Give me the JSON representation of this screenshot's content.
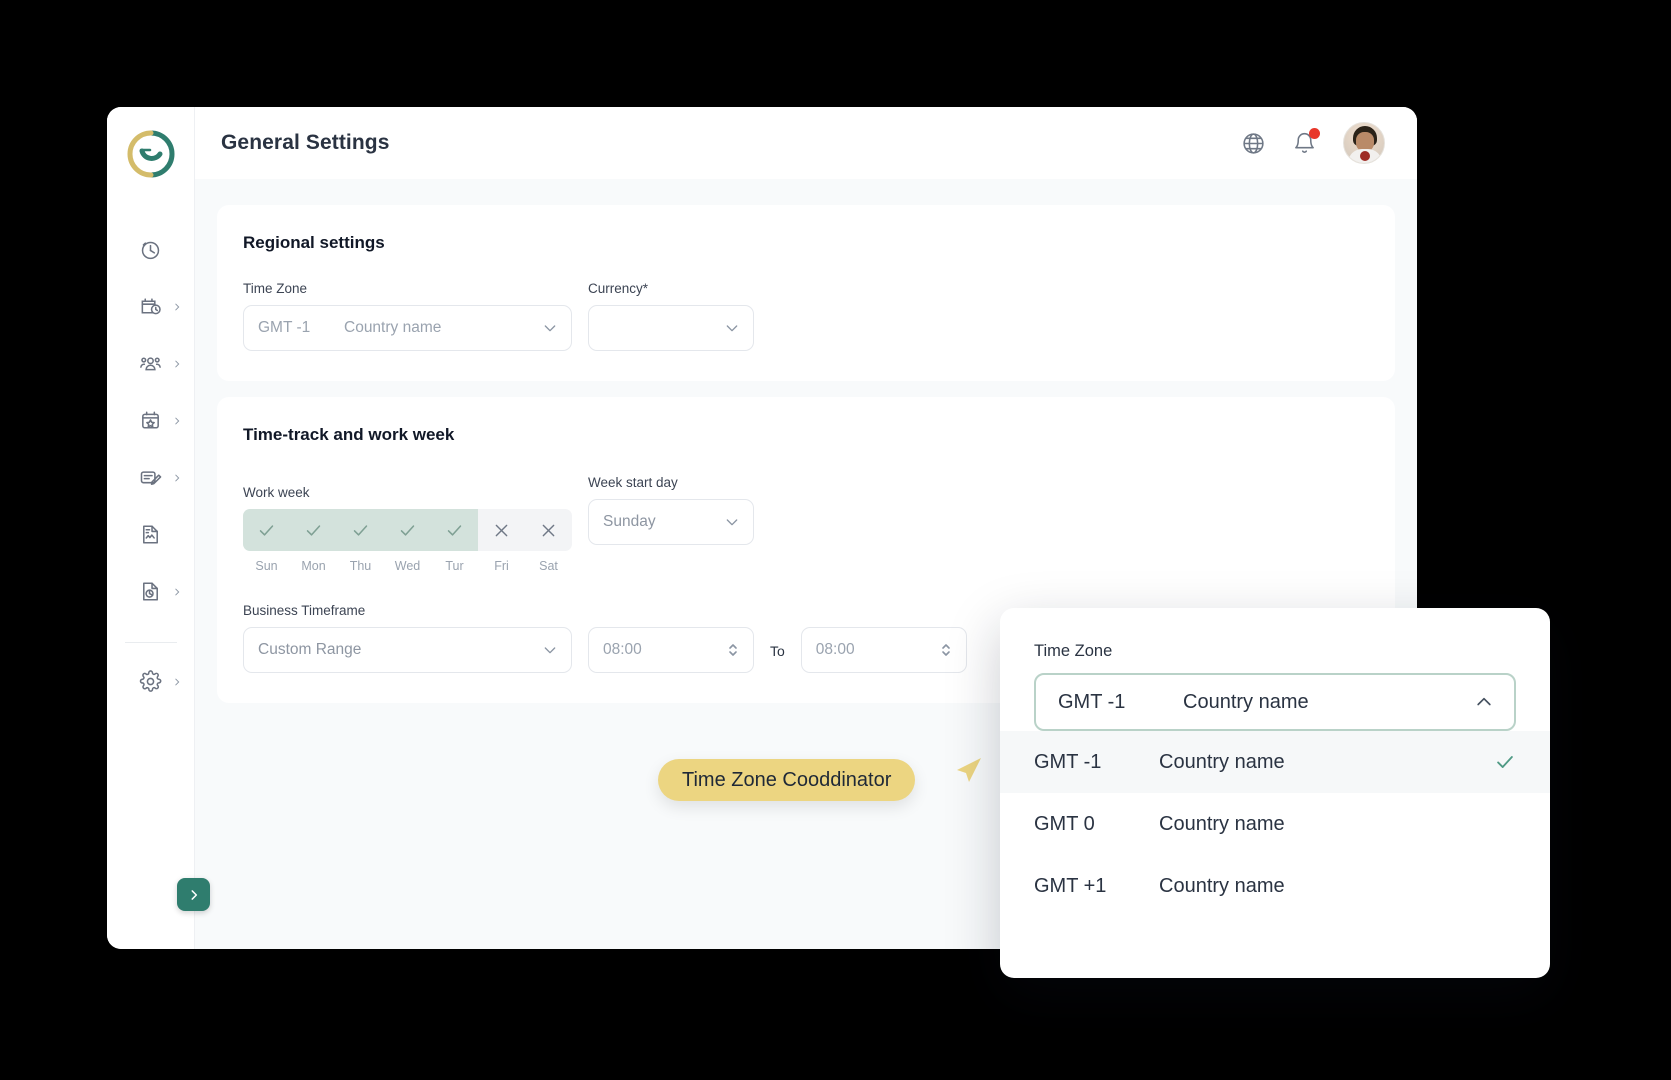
{
  "header": {
    "title": "General Settings",
    "icons": {
      "globe": "globe-icon",
      "bell": "bell-icon",
      "avatar": "user-avatar"
    }
  },
  "sidebar": {
    "logo": "app-logo",
    "items": [
      {
        "icon": "timer-icon",
        "name": "time-tracking",
        "expandable": false
      },
      {
        "icon": "calendar-clock-icon",
        "name": "schedule",
        "expandable": true
      },
      {
        "icon": "people-icon",
        "name": "team",
        "expandable": true
      },
      {
        "icon": "calendar-star-icon",
        "name": "events",
        "expandable": true
      },
      {
        "icon": "document-edit-icon",
        "name": "requests",
        "expandable": true
      },
      {
        "icon": "document-chart-icon",
        "name": "payroll",
        "expandable": false
      },
      {
        "icon": "document-pie-icon",
        "name": "reports",
        "expandable": true
      },
      {
        "icon": "gear-icon",
        "name": "settings",
        "expandable": true
      }
    ],
    "toggle": "expand-sidebar"
  },
  "regional": {
    "title": "Regional settings",
    "timezone": {
      "label": "Time Zone",
      "gmt": "GMT -1",
      "country": "Country name"
    },
    "currency": {
      "label": "Currency*",
      "value": ""
    }
  },
  "timetrack": {
    "title": "Time-track and work week",
    "work_week": {
      "label": "Work week",
      "days": [
        {
          "label": "Sun",
          "enabled": true
        },
        {
          "label": "Mon",
          "enabled": true
        },
        {
          "label": "Thu",
          "enabled": true
        },
        {
          "label": "Wed",
          "enabled": true
        },
        {
          "label": "Tur",
          "enabled": true
        },
        {
          "label": "Fri",
          "enabled": false
        },
        {
          "label": "Sat",
          "enabled": false
        }
      ]
    },
    "week_start": {
      "label": "Week start day",
      "value": "Sunday"
    },
    "business_timeframe": {
      "label": "Business Timeframe",
      "range_value": "Custom Range",
      "from_value": "08:00",
      "to_label": "To",
      "to_value": "08:00"
    }
  },
  "timezone_panel": {
    "label": "Time Zone",
    "selected": {
      "gmt": "GMT -1",
      "country": "Country name"
    },
    "options": [
      {
        "gmt": "GMT -1",
        "country": "Country name",
        "selected": true
      },
      {
        "gmt": "GMT 0",
        "country": "Country name",
        "selected": false
      },
      {
        "gmt": "GMT +1",
        "country": "Country name",
        "selected": false
      }
    ]
  },
  "callout": {
    "text": "Time Zone Cooddinator"
  },
  "colors": {
    "accent_green": "#2f7d6e",
    "accent_yellow": "#ecd581",
    "chip_green": "#d3e2dc",
    "notification_red": "#e8372a",
    "page_bg": "#f8fafb"
  }
}
